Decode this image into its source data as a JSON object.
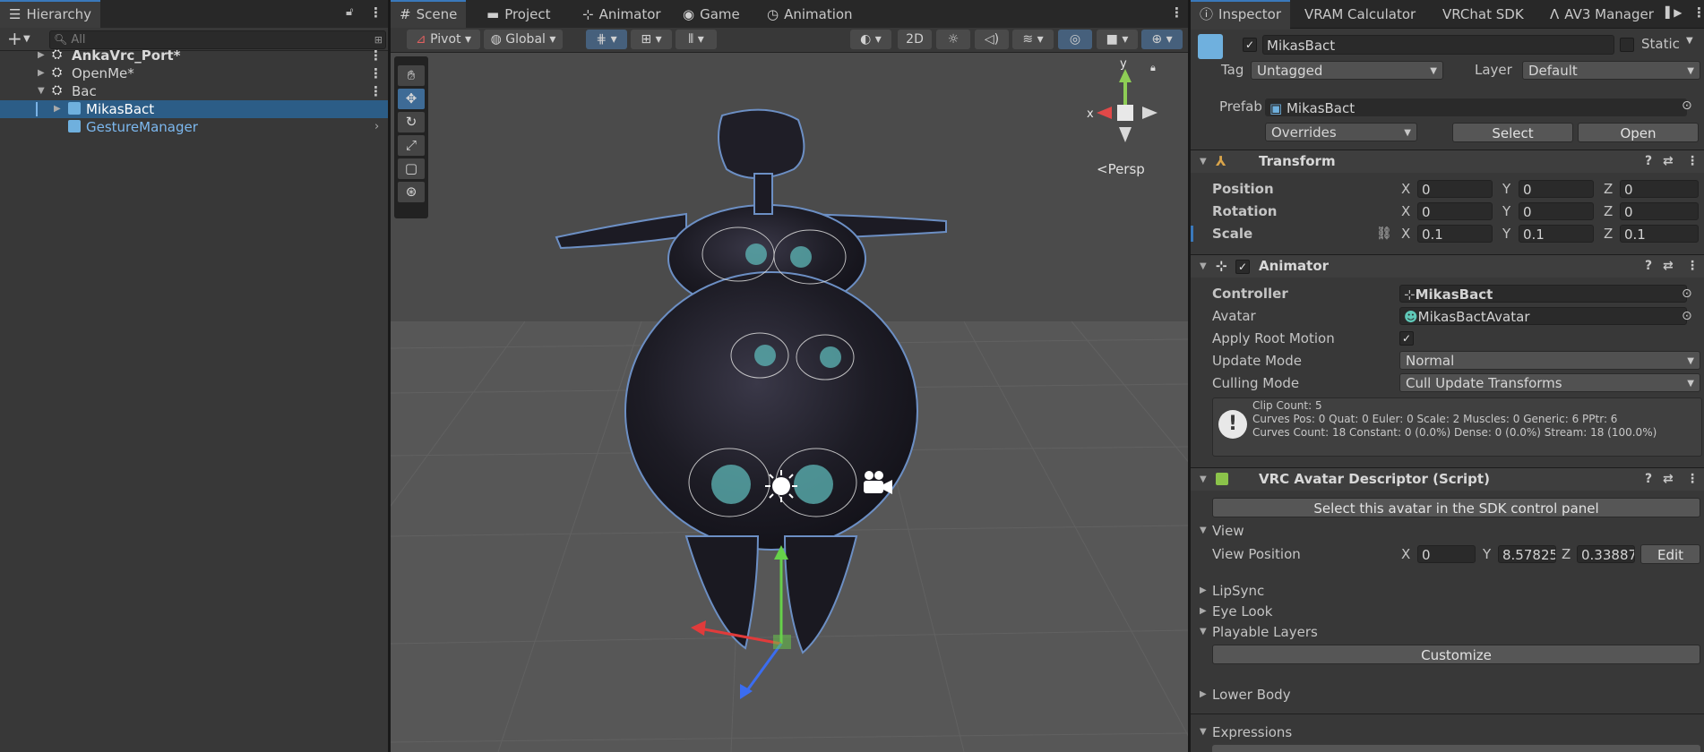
{
  "hierarchy": {
    "tab": "Hierarchy",
    "search_placeholder": "All",
    "items": [
      {
        "label": "AnkaVrc_Port*"
      },
      {
        "label": "OpenMe*"
      },
      {
        "label": "Bac"
      },
      {
        "label": "MikasBact"
      },
      {
        "label": "GestureManager"
      }
    ]
  },
  "scene": {
    "tabs": [
      {
        "label": "Scene"
      },
      {
        "label": "Project"
      },
      {
        "label": "Animator"
      },
      {
        "label": "Game"
      },
      {
        "label": "Animation"
      }
    ],
    "pivot_label": "Pivot",
    "global_label": "Global",
    "mode_2d": "2D",
    "persp_label": "<Persp",
    "gizmo_x": "x",
    "gizmo_y": "y"
  },
  "inspector": {
    "tabs": [
      {
        "label": "Inspector"
      },
      {
        "label": "VRAM Calculator"
      },
      {
        "label": "VRChat SDK"
      },
      {
        "label": "AV3 Manager"
      }
    ],
    "object_name": "MikasBact",
    "static_label": "Static",
    "tag_label": "Tag",
    "tag_value": "Untagged",
    "layer_label": "Layer",
    "layer_value": "Default",
    "prefab_label": "Prefab",
    "prefab_value": "MikasBact",
    "overrides_label": "Overrides",
    "select_button": "Select",
    "open_button": "Open",
    "transform": {
      "title": "Transform",
      "position_label": "Position",
      "rotation_label": "Rotation",
      "scale_label": "Scale",
      "position": [
        "0",
        "0",
        "0"
      ],
      "rotation": [
        "0",
        "0",
        "0"
      ],
      "scale": [
        "0.1",
        "0.1",
        "0.1"
      ],
      "axes": [
        "X",
        "Y",
        "Z"
      ]
    },
    "animator": {
      "title": "Animator",
      "controller_label": "Controller",
      "controller_value": "MikasBact",
      "avatar_label": "Avatar",
      "avatar_value": "MikasBactAvatar",
      "root_motion_label": "Apply Root Motion",
      "update_mode_label": "Update Mode",
      "update_mode_value": "Normal",
      "culling_mode_label": "Culling Mode",
      "culling_mode_value": "Cull Update Transforms",
      "info_line1": "Clip Count: 5",
      "info_line2": "Curves Pos: 0 Quat: 0 Euler: 0 Scale: 2 Muscles: 0 Generic: 6 PPtr: 6",
      "info_line3": "Curves Count: 18 Constant: 0 (0.0%) Dense: 0 (0.0%) Stream: 18 (100.0%)"
    },
    "descriptor": {
      "title": "VRC Avatar Descriptor (Script)",
      "select_button": "Select this avatar in the SDK control panel",
      "view_label": "View",
      "view_position_label": "View Position",
      "view_position": [
        "0",
        "8.57825",
        "0.33887"
      ],
      "edit_button": "Edit",
      "lipsync_label": "LipSync",
      "eyelook_label": "Eye Look",
      "playable_layers_label": "Playable Layers",
      "customize_button": "Customize",
      "lower_body_label": "Lower Body",
      "expressions_label": "Expressions"
    }
  }
}
